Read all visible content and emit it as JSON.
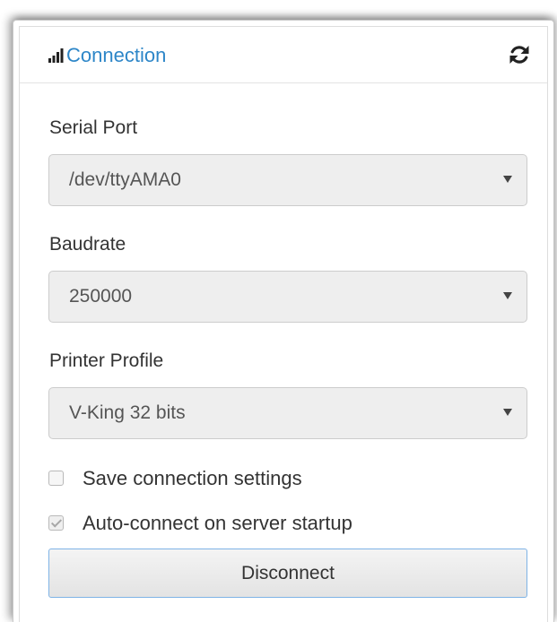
{
  "header": {
    "icon": "signal-bars-icon",
    "title": "Connection",
    "refresh_icon": "refresh-icon",
    "title_color": "#2d86c8"
  },
  "serial_port": {
    "label": "Serial Port",
    "value": "/dev/ttyAMA0"
  },
  "baudrate": {
    "label": "Baudrate",
    "value": "250000"
  },
  "printer_profile": {
    "label": "Printer Profile",
    "value": "V-King 32 bits"
  },
  "options": {
    "save_settings": {
      "label": "Save connection settings",
      "checked": false
    },
    "auto_connect": {
      "label": "Auto-connect on server startup",
      "checked": true,
      "disabled": true
    }
  },
  "actions": {
    "disconnect_label": "Disconnect",
    "button_border": "#7eb3e6"
  }
}
